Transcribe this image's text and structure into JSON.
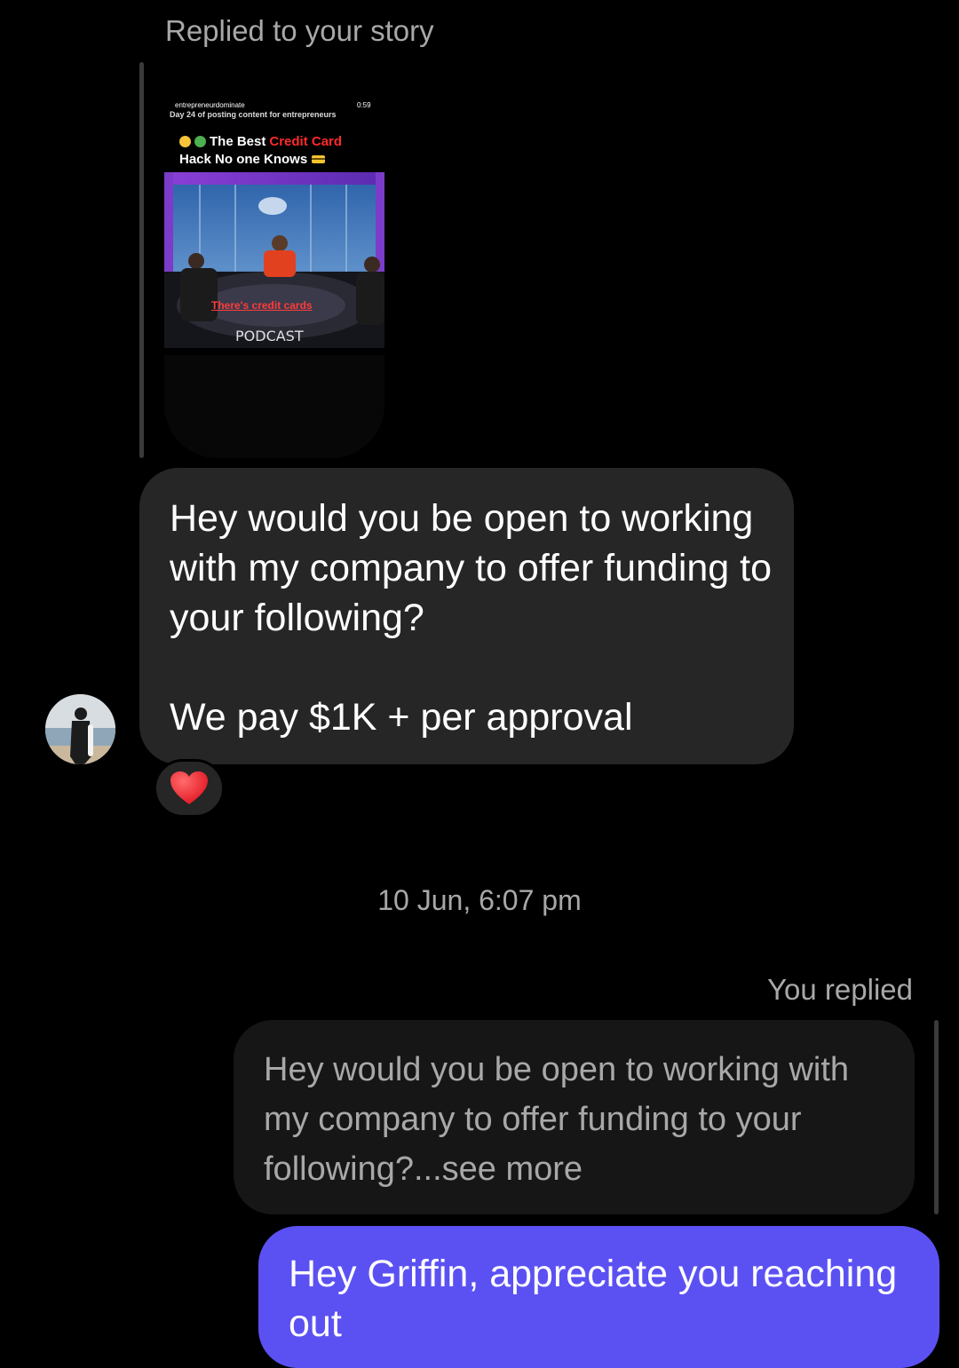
{
  "story_reply": {
    "caption": "Replied to your story",
    "story": {
      "username": "entrepreneurdominate",
      "duration": "0:59",
      "subtitle": "Day 24 of posting content for entrepreneurs",
      "title_part1": "The Best",
      "title_part2": "Credit Card",
      "title_line2": "Hack No one Knows",
      "video_caption": "There's credit cards"
    }
  },
  "incoming_message": {
    "text": "Hey would you be open to working with my company to offer funding to your following?\n\nWe pay $1K + per approval",
    "reaction": "heart-emoji"
  },
  "timestamp": "10 Jun, 6:07 pm",
  "reply": {
    "label": "You replied",
    "quoted_text": "Hey would you be open to working with my company to offer funding to your following?...see more",
    "message_text": "Hey Griffin, appreciate you reaching out"
  },
  "colors": {
    "background": "#000000",
    "incoming_bubble": "#262626",
    "outgoing_bubble": "#5b51f3",
    "muted_text": "#a8a8a8"
  }
}
